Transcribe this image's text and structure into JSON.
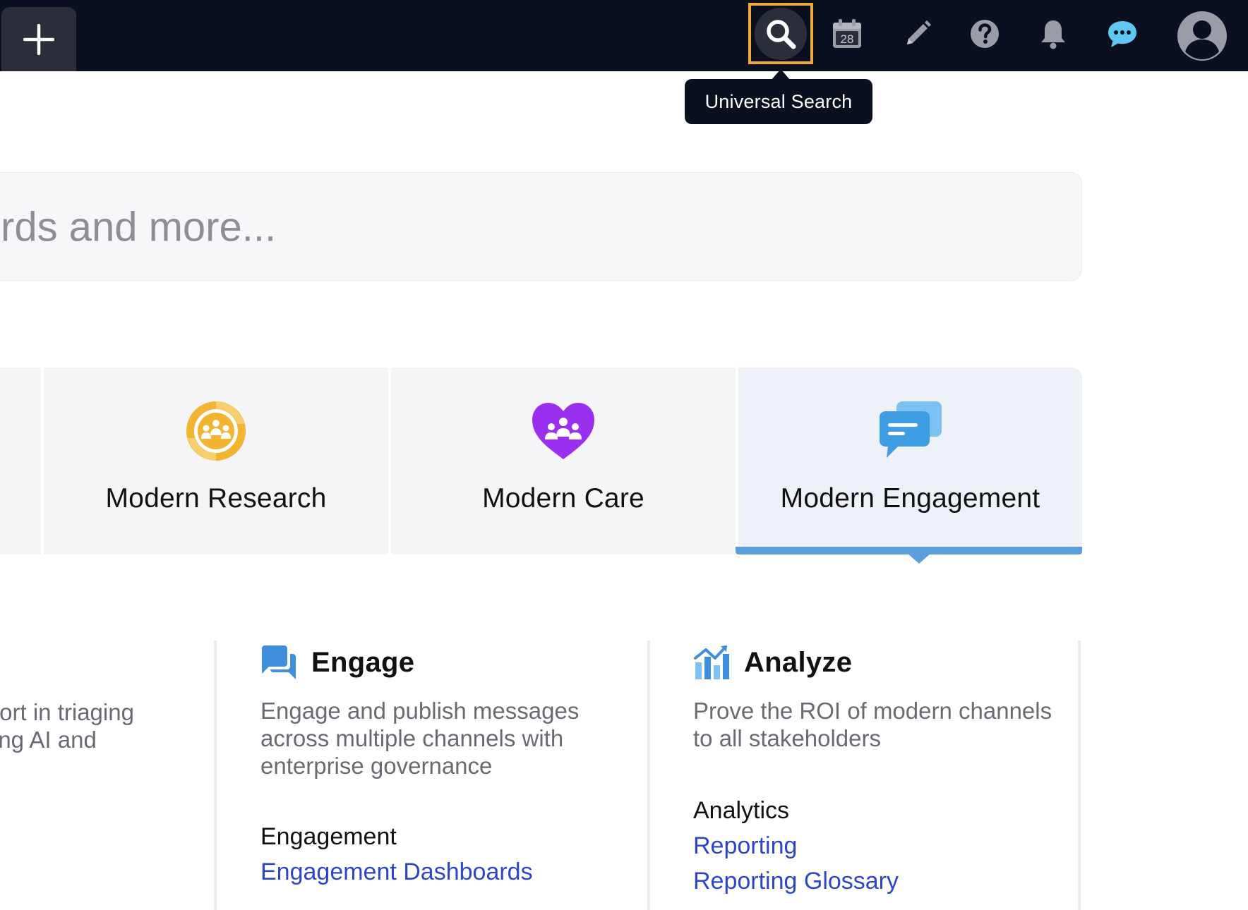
{
  "topbar": {
    "calendar_day": "28",
    "active_tooltip": "Universal Search"
  },
  "search": {
    "placeholder_visible": "rds and more..."
  },
  "tiles": [
    {
      "label": "Modern Research",
      "icon": "research-cycle-icon",
      "color": "#f2b431"
    },
    {
      "label": "Modern Care",
      "icon": "heart-people-icon",
      "color": "#9b2ff0"
    },
    {
      "label": "Modern Engagement",
      "icon": "chat-bubbles-icon",
      "color": "#3f9de3",
      "selected": true
    }
  ],
  "columns": {
    "partial": {
      "desc_line1": "fort in triaging",
      "desc_line2": "ing AI and"
    },
    "engage": {
      "icon": "chat-icon",
      "title": "Engage",
      "desc": "Engage and publish messages across multiple channels with enterprise governance",
      "section": "Engagement",
      "links": [
        "Engagement Dashboards"
      ]
    },
    "analyze": {
      "icon": "bar-chart-icon",
      "title": "Analyze",
      "desc": "Prove the ROI of modern channels to all stakeholders",
      "section": "Analytics",
      "links": [
        "Reporting",
        "Reporting Glossary"
      ]
    }
  },
  "colors": {
    "topbar_bg": "#0b1020",
    "highlight_border": "#f2a93b",
    "selected_underline": "#5a9edb",
    "link": "#2f45c8"
  }
}
